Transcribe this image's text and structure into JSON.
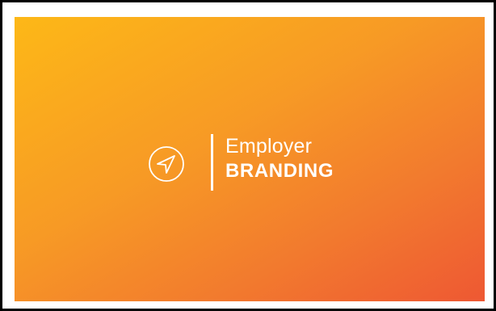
{
  "banner": {
    "gradient_colors": [
      "#fdb817",
      "#f79a25",
      "#f27a2e",
      "#ee5833"
    ],
    "logo": {
      "icon": "navigation-arrow-icon",
      "line1": "Employer",
      "line2": "BRANDING",
      "text_color": "#ffffff"
    }
  }
}
